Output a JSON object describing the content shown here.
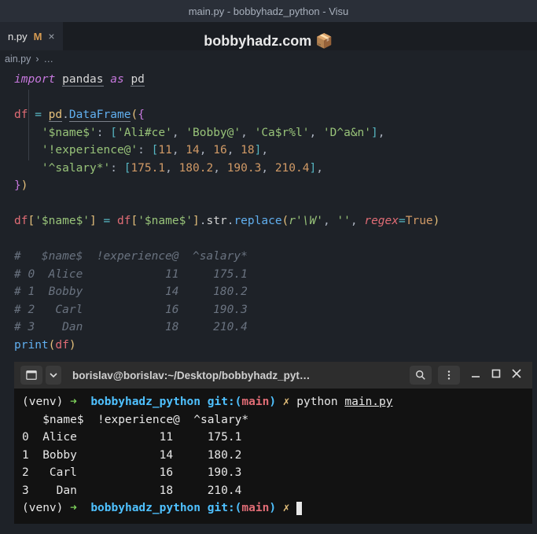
{
  "title_bar": "main.py - bobbyhadz_python - Visu",
  "watermark": "bobbyhadz.com 📦",
  "tab": {
    "label": "n.py",
    "modified": "M",
    "close": "×"
  },
  "breadcrumb": {
    "file": "ain.py",
    "sep": "›",
    "more": "…"
  },
  "code": {
    "import_kw": "import",
    "pandas": "pandas",
    "as_kw": "as",
    "pd": "pd",
    "df": "df",
    "eq": "=",
    "dot": ".",
    "DataFrame": "DataFrame",
    "lp": "(",
    "rp": ")",
    "lb": "{",
    "rb": "}",
    "lbk": "[",
    "rbk": "]",
    "comma": ",",
    "colon": ":",
    "key_name": "'$name$'",
    "key_exp": "'!experience@'",
    "key_sal": "'^salary*'",
    "names": [
      "'Ali#ce'",
      "'Bobby@'",
      "'Ca$r%l'",
      "'D^a&n'"
    ],
    "exps": [
      "11",
      "14",
      "16",
      "18"
    ],
    "sals": [
      "175.1",
      "180.2",
      "190.3",
      "210.4"
    ],
    "str_attr": "str",
    "replace": "replace",
    "raw_regex": "r'\\W'",
    "empty": "''",
    "regex_kw": "regex",
    "true": "True",
    "print": "print",
    "comments": [
      "#   $name$  !experience@  ^salary*",
      "# 0  Alice            11     175.1",
      "# 1  Bobby            14     180.2",
      "# 2   Carl            16     190.3",
      "# 3    Dan            18     210.4"
    ]
  },
  "terminal": {
    "header_title": "borislav@borislav:~/Desktop/bobbyhadz_pyt…",
    "venv": "(venv)",
    "arrow": "➜",
    "path": "bobbyhadz_python",
    "git": "git:",
    "branch": "main",
    "cross": "✗",
    "cmd": "python",
    "file": "main.py",
    "out_header": "   $name$  !experience@  ^salary*",
    "rows": [
      "0  Alice            11     175.1",
      "1  Bobby            14     180.2",
      "2   Carl            16     190.3",
      "3    Dan            18     210.4"
    ]
  }
}
